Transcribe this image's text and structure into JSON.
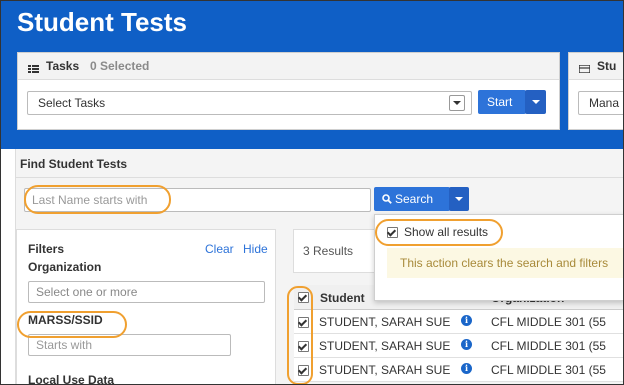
{
  "page_title": "Student Tests",
  "tasks_panel": {
    "title": "Tasks",
    "selected_count": "0 Selected",
    "select_value": "Select Tasks",
    "start_label": "Start"
  },
  "second_panel": {
    "title_fragment": "Stu",
    "select_fragment": "Mana"
  },
  "find": {
    "heading": "Find Student Tests",
    "last_name_placeholder": "Last Name starts with",
    "search_label": "Search"
  },
  "dropdown": {
    "show_all_label": "Show all results",
    "warning": "This action clears the search and filters"
  },
  "filters": {
    "title": "Filters",
    "clear_label": "Clear",
    "hide_label": "Hide",
    "organization_label": "Organization",
    "organization_placeholder": "Select one or more",
    "marss_label": "MARSS/SSID",
    "marss_placeholder": "Starts with",
    "local_use_label": "Local Use Data"
  },
  "results": {
    "count_text": "3 Results",
    "columns": [
      "Student",
      "Organization"
    ],
    "rows": [
      {
        "student": "STUDENT, SARAH SUE",
        "organization": "CFL MIDDLE 301 (55"
      },
      {
        "student": "STUDENT, SARAH SUE",
        "organization": "CFL MIDDLE 301 (55"
      },
      {
        "student": "STUDENT, SARAH SUE",
        "organization": "CFL MIDDLE 301 (55"
      }
    ]
  },
  "colors": {
    "header_blue": "#0f5fc6",
    "button_blue": "#2d73d9",
    "highlight_orange": "#f0a030"
  }
}
